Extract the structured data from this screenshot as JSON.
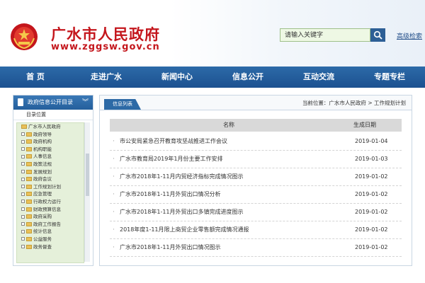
{
  "header": {
    "site_title": "广水市人民政府",
    "site_url": "www.zggsw.gov.cn",
    "search_placeholder": "请输入关键字",
    "advanced_search": "高级检索"
  },
  "nav": {
    "items": [
      {
        "label": "首  页"
      },
      {
        "label": "走进广水"
      },
      {
        "label": "新闻中心"
      },
      {
        "label": "信息公开"
      },
      {
        "label": "互动交流"
      },
      {
        "label": "专题专栏"
      }
    ]
  },
  "sidebar": {
    "title": "政府信息公开目录",
    "subtitle": "目录位置",
    "tree_root": "广水市人民政府",
    "tree_items": [
      {
        "label": "政府领导"
      },
      {
        "label": "政府机构"
      },
      {
        "label": "机构职能"
      },
      {
        "label": "人事信息"
      },
      {
        "label": "政策法规"
      },
      {
        "label": "发展规划"
      },
      {
        "label": "政府会议"
      },
      {
        "label": "工作规划计划"
      },
      {
        "label": "应急管理"
      },
      {
        "label": "行政权力运行"
      },
      {
        "label": "财政预算信息"
      },
      {
        "label": "政府采购"
      },
      {
        "label": "政府工作报告"
      },
      {
        "label": "统计信息"
      },
      {
        "label": "公益服务"
      },
      {
        "label": "政务督查"
      }
    ]
  },
  "content": {
    "tab_label": "信息列表",
    "breadcrumb": "当前位置：广水市人民政府 > 工作规划计划",
    "col_title": "名称",
    "col_date": "生成日期",
    "rows": [
      {
        "title": "市公安局紧急召开教育攻坚战推进工作会议",
        "date": "2019-01-04"
      },
      {
        "title": "广水市教育局2019年1月份主要工作安排",
        "date": "2019-01-03"
      },
      {
        "title": "广水市2018年1-11月内贸经济指标完成情况图示",
        "date": "2019-01-02"
      },
      {
        "title": "广水市2018年1-11月外贸出口情况分析",
        "date": "2019-01-02"
      },
      {
        "title": "广水市2018年1-11月外贸出口多镇完成进度图示",
        "date": "2019-01-02"
      },
      {
        "title": "2018年度1-11月限上商贸企业零售额完成情况通报",
        "date": "2019-01-02"
      },
      {
        "title": "广水市2018年1-11月外贸出口情况图示",
        "date": "2019-01-02"
      }
    ]
  },
  "colors": {
    "brand_red": "#c4161c",
    "nav_blue": "#1c5190",
    "tree_green": "#e5f0da"
  }
}
